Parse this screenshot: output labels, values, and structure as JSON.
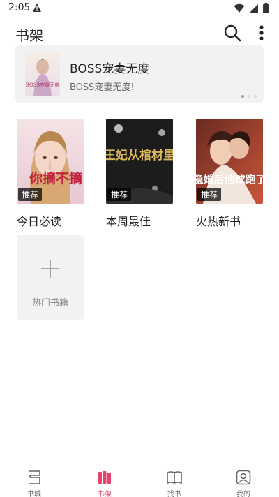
{
  "status_bar": {
    "time": "2:05"
  },
  "header": {
    "title": "书架"
  },
  "banner": {
    "title": "BOSS宠妻无度",
    "subtitle": "BOSS宠妻无度!",
    "cover_text": "BOSS宠妻无度"
  },
  "books": [
    {
      "title": "今日必读",
      "tag": "推荐",
      "cover_text": "你摘不摘"
    },
    {
      "title": "本周最佳",
      "tag": "推荐",
      "cover_text": "王妃从棺材里"
    },
    {
      "title": "火热新书",
      "tag": "推荐",
      "cover_text": "隐婚后他球跑了"
    }
  ],
  "add_card": {
    "label": "热门书籍"
  },
  "bottom_nav": {
    "items": [
      {
        "label": "书城",
        "icon": "bookstore-icon"
      },
      {
        "label": "书架",
        "icon": "bookshelf-icon",
        "active": true
      },
      {
        "label": "找书",
        "icon": "open-book-icon"
      },
      {
        "label": "我的",
        "icon": "profile-icon"
      }
    ]
  },
  "colors": {
    "accent": "#e5456d",
    "card_bg": "#f2f2f2"
  }
}
